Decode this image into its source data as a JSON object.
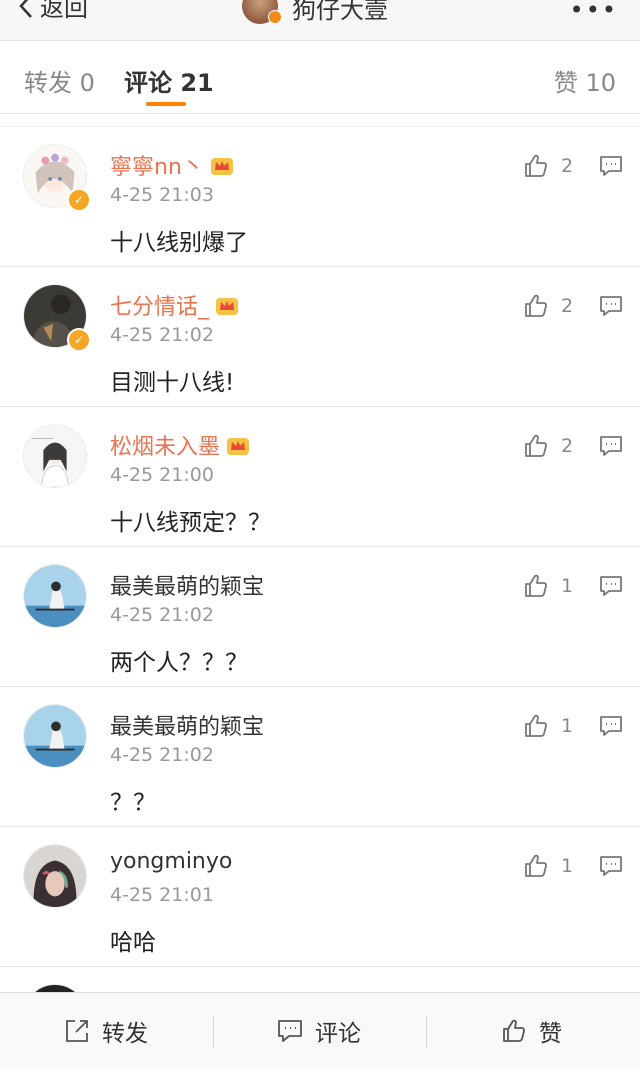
{
  "nav": {
    "back_label": "返回",
    "title": "狗仔大壹",
    "more": "•••"
  },
  "tabs": {
    "repost": "转发 0",
    "comment": "评论 21",
    "like": "赞 10"
  },
  "comments": [
    {
      "name": "寧寧nn丶",
      "vip": true,
      "verified": true,
      "time": "4-25 21:03",
      "text": "十八线别爆了",
      "likes": "2"
    },
    {
      "name": "七分情话_",
      "vip": true,
      "verified": true,
      "time": "4-25 21:02",
      "text": "目测十八线!",
      "likes": "2"
    },
    {
      "name": "松烟未入墨",
      "vip": true,
      "verified": false,
      "time": "4-25 21:00",
      "text": "十八线预定？？",
      "likes": "2"
    },
    {
      "name": "最美最萌的颖宝",
      "vip": false,
      "verified": false,
      "time": "4-25 21:02",
      "text": "两个人？？？",
      "likes": "1"
    },
    {
      "name": "最美最萌的颖宝",
      "vip": false,
      "verified": false,
      "time": "4-25 21:02",
      "text": "？？",
      "likes": "1"
    },
    {
      "name": "yongminyo",
      "vip": false,
      "verified": false,
      "time": "4-25 21:01",
      "text": "哈哈",
      "likes": "1"
    }
  ],
  "bottom_bar": {
    "repost": "转发",
    "comment": "评论",
    "like": "赞"
  },
  "colors": {
    "accent": "#ff8200",
    "vip_name": "#eb7350",
    "verified": "#f5a623"
  }
}
